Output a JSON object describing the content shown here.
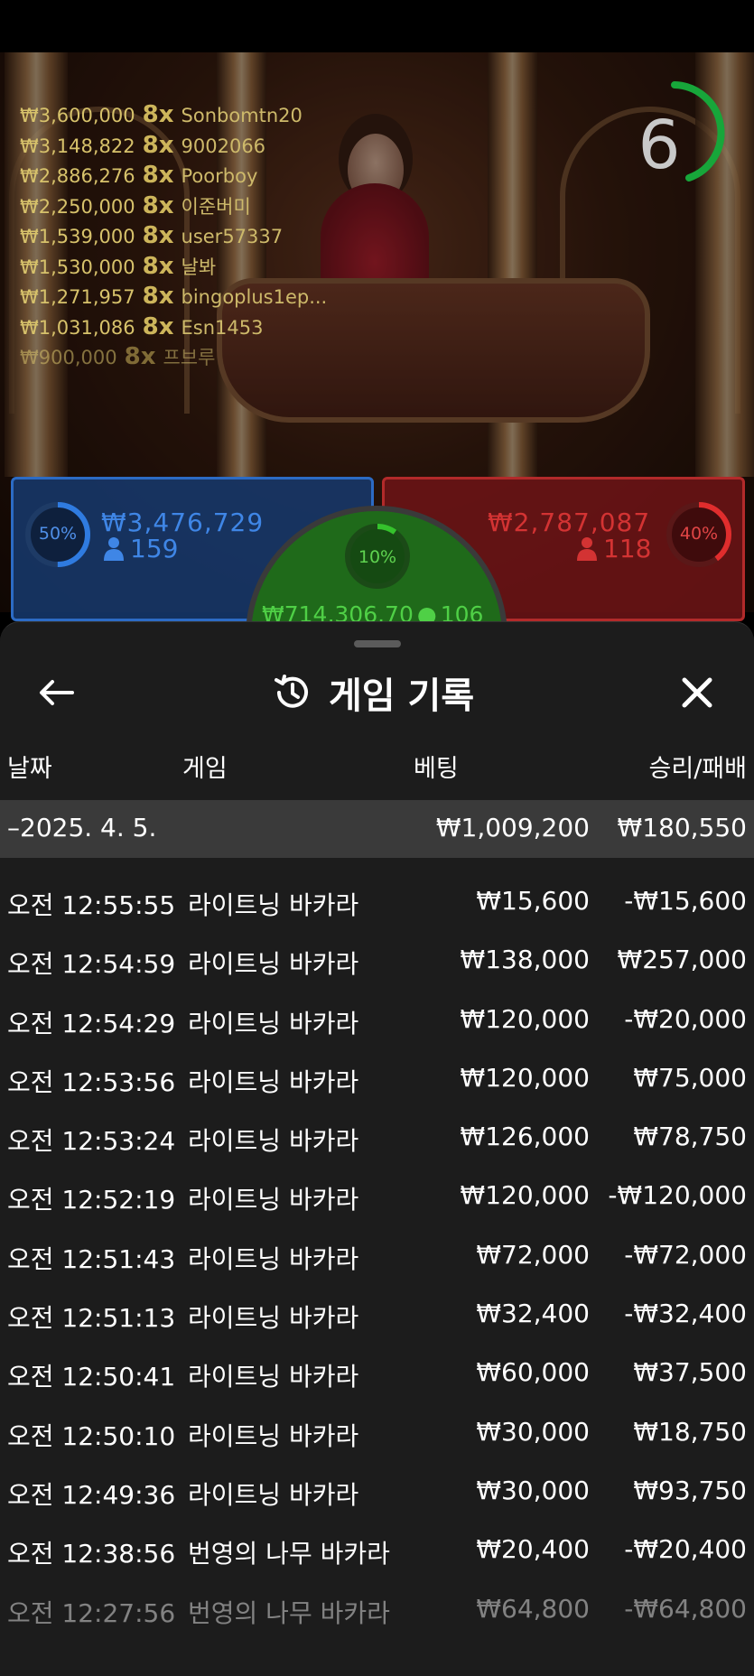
{
  "video": {
    "timer": "6",
    "top_winners": [
      {
        "amount": "₩3,600,000",
        "multiplier": "8x",
        "name": "Sonbomtn20"
      },
      {
        "amount": "₩3,148,822",
        "multiplier": "8x",
        "name": "9002066"
      },
      {
        "amount": "₩2,886,276",
        "multiplier": "8x",
        "name": "Poorboy"
      },
      {
        "amount": "₩2,250,000",
        "multiplier": "8x",
        "name": "이준버미"
      },
      {
        "amount": "₩1,539,000",
        "multiplier": "8x",
        "name": "user57337"
      },
      {
        "amount": "₩1,530,000",
        "multiplier": "8x",
        "name": "날봐"
      },
      {
        "amount": "₩1,271,957",
        "multiplier": "8x",
        "name": "bingoplus1ep..."
      },
      {
        "amount": "₩1,031,086",
        "multiplier": "8x",
        "name": "Esn1453"
      },
      {
        "amount": "₩900,000",
        "multiplier": "8x",
        "name": "프브루"
      }
    ]
  },
  "bets": {
    "player": {
      "percent": "50%",
      "percent_value": 0.5,
      "amount": "₩3,476,729",
      "count": "159",
      "color": "#2f7be0"
    },
    "banker": {
      "percent": "40%",
      "percent_value": 0.4,
      "amount": "₩2,787,087",
      "count": "118",
      "color": "#e02d2d"
    },
    "tie": {
      "percent": "10%",
      "percent_value": 0.1,
      "amount": "₩714,306.70",
      "count": "106",
      "color": "#35c22c"
    }
  },
  "history": {
    "title": "게임 기록",
    "columns": {
      "date": "날짜",
      "game": "게임",
      "bet": "베팅",
      "win_loss": "승리/패배"
    },
    "summary": {
      "date": "–2025. 4. 5.",
      "bet": "₩1,009,200",
      "win_loss": "₩180,550"
    },
    "rows": [
      {
        "time": "오전 12:55:55",
        "game": "라이트닝 바카라",
        "bet": "₩15,600",
        "win_loss": "-₩15,600"
      },
      {
        "time": "오전 12:54:59",
        "game": "라이트닝 바카라",
        "bet": "₩138,000",
        "win_loss": "₩257,000"
      },
      {
        "time": "오전 12:54:29",
        "game": "라이트닝 바카라",
        "bet": "₩120,000",
        "win_loss": "-₩20,000"
      },
      {
        "time": "오전 12:53:56",
        "game": "라이트닝 바카라",
        "bet": "₩120,000",
        "win_loss": "₩75,000"
      },
      {
        "time": "오전 12:53:24",
        "game": "라이트닝 바카라",
        "bet": "₩126,000",
        "win_loss": "₩78,750"
      },
      {
        "time": "오전 12:52:19",
        "game": "라이트닝 바카라",
        "bet": "₩120,000",
        "win_loss": "-₩120,000"
      },
      {
        "time": "오전 12:51:43",
        "game": "라이트닝 바카라",
        "bet": "₩72,000",
        "win_loss": "-₩72,000"
      },
      {
        "time": "오전 12:51:13",
        "game": "라이트닝 바카라",
        "bet": "₩32,400",
        "win_loss": "-₩32,400"
      },
      {
        "time": "오전 12:50:41",
        "game": "라이트닝 바카라",
        "bet": "₩60,000",
        "win_loss": "₩37,500"
      },
      {
        "time": "오전 12:50:10",
        "game": "라이트닝 바카라",
        "bet": "₩30,000",
        "win_loss": "₩18,750"
      },
      {
        "time": "오전 12:49:36",
        "game": "라이트닝 바카라",
        "bet": "₩30,000",
        "win_loss": "₩93,750"
      },
      {
        "time": "오전 12:38:56",
        "game": "번영의 나무 바카라",
        "bet": "₩20,400",
        "win_loss": "-₩20,400"
      },
      {
        "time": "오전 12:27:56",
        "game": "번영의 나무 바카라",
        "bet": "₩64,800",
        "win_loss": "-₩64,800"
      }
    ]
  }
}
